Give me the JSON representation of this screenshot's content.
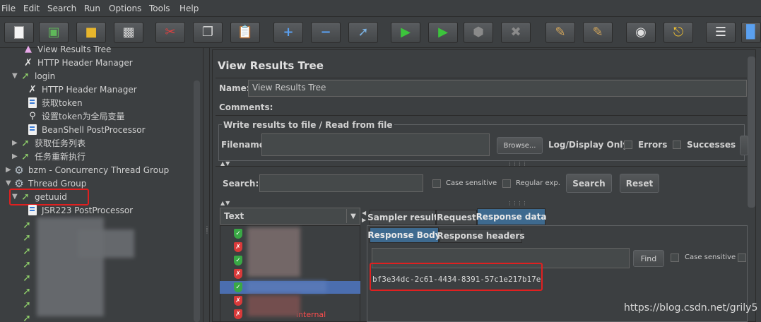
{
  "menu": [
    "File",
    "Edit",
    "Search",
    "Run",
    "Options",
    "Tools",
    "Help"
  ],
  "toolbar": [
    {
      "icon": "new-icon"
    },
    {
      "icon": "templates-icon"
    },
    {
      "icon": "open-icon"
    },
    {
      "icon": "save-icon"
    },
    {
      "icon": "cut-icon"
    },
    {
      "icon": "copy-icon"
    },
    {
      "icon": "paste-icon"
    },
    {
      "icon": "expand-icon"
    },
    {
      "icon": "collapse-icon"
    },
    {
      "icon": "toggle-icon"
    },
    {
      "icon": "start-icon"
    },
    {
      "icon": "start-no-pause-icon"
    },
    {
      "icon": "stop-icon"
    },
    {
      "icon": "shutdown-icon"
    },
    {
      "icon": "clear-icon"
    },
    {
      "icon": "clear-all-icon"
    },
    {
      "icon": "search-icon"
    },
    {
      "icon": "reset-search-icon"
    },
    {
      "icon": "function-helper-icon"
    },
    {
      "icon": "help-icon"
    }
  ],
  "tree": {
    "items": [
      {
        "label": "View Results Tree",
        "icon": "listener-icon"
      },
      {
        "label": "HTTP Header Manager",
        "icon": "wrench-icon"
      },
      {
        "label": "login",
        "icon": "sampler-icon"
      },
      {
        "label": "HTTP Header Manager",
        "icon": "wrench-icon"
      },
      {
        "label": "获取token",
        "icon": "script-icon"
      },
      {
        "label": "设置token为全局变量",
        "icon": "magnifier-icon"
      },
      {
        "label": "BeanShell PostProcessor",
        "icon": "script-icon"
      },
      {
        "label": "获取任务列表",
        "icon": "sampler-icon"
      },
      {
        "label": "任务重新执行",
        "icon": "sampler-icon"
      },
      {
        "label": "bzm - Concurrency Thread Group",
        "icon": "gear-icon"
      },
      {
        "label": "Thread Group",
        "icon": "gear-icon"
      },
      {
        "label": "getuuid",
        "icon": "sampler-icon"
      },
      {
        "label": "JSR223 PostProcessor",
        "icon": "script-icon"
      }
    ]
  },
  "panel": {
    "title": "View Results Tree",
    "name_label": "Name:",
    "name_value": "View Results Tree",
    "comments_label": "Comments:",
    "file_legend": "Write results to file / Read from file",
    "filename_label": "Filename",
    "browse_label": "Browse...",
    "log_display_label": "Log/Display Only:",
    "errors_label": "Errors",
    "successes_label": "Successes",
    "search_label": "Search:",
    "case_sensitive_label": "Case sensitive",
    "regular_exp_label": "Regular exp.",
    "search_button": "Search",
    "reset_button": "Reset"
  },
  "results": {
    "renderer": "Text",
    "rows": [
      {
        "status": "ok"
      },
      {
        "status": "error"
      },
      {
        "status": "ok"
      },
      {
        "status": "error"
      },
      {
        "status": "ok",
        "selected": true
      },
      {
        "status": "error"
      },
      {
        "status": "error",
        "text": "internal"
      }
    ]
  },
  "tabs": {
    "main": [
      "Sampler result",
      "Request",
      "Response data"
    ],
    "sub": [
      "Response Body",
      "Response headers"
    ]
  },
  "response": {
    "find_label": "Find",
    "case_sensitive_label": "Case sensitive",
    "body": "bf3e34dc-2c61-4434-8391-57c1e217b17e"
  },
  "watermark": "https://blog.csdn.net/grily5"
}
